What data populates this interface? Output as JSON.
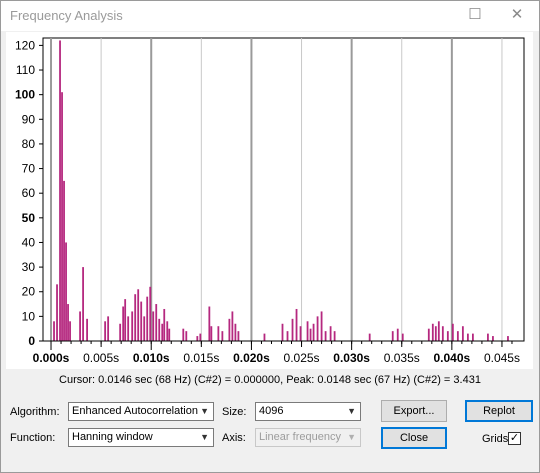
{
  "window": {
    "title": "Frequency Analysis",
    "maximize_glyph": "☐",
    "close_glyph": "✕"
  },
  "chart_data": {
    "type": "bar",
    "y_ticks": [
      "120",
      "110",
      "100",
      "90",
      "80",
      "70",
      "60",
      "50",
      "40",
      "30",
      "20",
      "10",
      "0"
    ],
    "bold_y_ticks": [
      "100",
      "50",
      "0"
    ],
    "x_ticks": [
      "0.000s",
      "0.005s",
      "0.010s",
      "0.015s",
      "0.020s",
      "0.025s",
      "0.030s",
      "0.035s",
      "0.040s",
      "0.045s"
    ],
    "bold_x_ticks": [
      "0.000s",
      "0.010s",
      "0.020s",
      "0.030s",
      "0.040s"
    ],
    "xlim": [
      -0.0008,
      0.0472
    ],
    "ylim": [
      0,
      123
    ],
    "grid": true,
    "color": "#b5287f",
    "points": [
      [
        0.0003,
        8
      ],
      [
        0.0006,
        23
      ],
      [
        0.0009,
        122
      ],
      [
        0.0011,
        101
      ],
      [
        0.0013,
        65
      ],
      [
        0.0015,
        40
      ],
      [
        0.0017,
        15
      ],
      [
        0.0019,
        8
      ],
      [
        0.0029,
        12
      ],
      [
        0.0032,
        30
      ],
      [
        0.0036,
        9
      ],
      [
        0.0054,
        8
      ],
      [
        0.0057,
        10
      ],
      [
        0.0069,
        7
      ],
      [
        0.0072,
        14
      ],
      [
        0.0074,
        17
      ],
      [
        0.0077,
        10
      ],
      [
        0.0081,
        12
      ],
      [
        0.0084,
        19
      ],
      [
        0.0087,
        21
      ],
      [
        0.009,
        16
      ],
      [
        0.0093,
        10
      ],
      [
        0.0096,
        18
      ],
      [
        0.0099,
        22
      ],
      [
        0.0102,
        12
      ],
      [
        0.0105,
        15
      ],
      [
        0.0108,
        9
      ],
      [
        0.0111,
        7
      ],
      [
        0.0113,
        13
      ],
      [
        0.0116,
        8
      ],
      [
        0.0118,
        5
      ],
      [
        0.0132,
        5
      ],
      [
        0.0135,
        4
      ],
      [
        0.0146,
        2
      ],
      [
        0.0149,
        3
      ],
      [
        0.0158,
        14
      ],
      [
        0.016,
        6
      ],
      [
        0.0167,
        6
      ],
      [
        0.0171,
        4
      ],
      [
        0.0178,
        9
      ],
      [
        0.0181,
        12
      ],
      [
        0.0184,
        7
      ],
      [
        0.0187,
        4
      ],
      [
        0.0213,
        3
      ],
      [
        0.0231,
        7
      ],
      [
        0.0236,
        4
      ],
      [
        0.0241,
        9
      ],
      [
        0.0245,
        13
      ],
      [
        0.0249,
        6
      ],
      [
        0.0256,
        8
      ],
      [
        0.0259,
        5
      ],
      [
        0.0262,
        7
      ],
      [
        0.0266,
        10
      ],
      [
        0.027,
        12
      ],
      [
        0.0274,
        4
      ],
      [
        0.0279,
        6
      ],
      [
        0.0283,
        4
      ],
      [
        0.0318,
        3
      ],
      [
        0.0341,
        4
      ],
      [
        0.0346,
        5
      ],
      [
        0.0351,
        3
      ],
      [
        0.0377,
        5
      ],
      [
        0.0381,
        7
      ],
      [
        0.0384,
        6
      ],
      [
        0.0387,
        8
      ],
      [
        0.0391,
        6
      ],
      [
        0.0396,
        4
      ],
      [
        0.0401,
        7
      ],
      [
        0.0406,
        4
      ],
      [
        0.0411,
        6
      ],
      [
        0.0416,
        3
      ],
      [
        0.0421,
        3
      ],
      [
        0.0436,
        3
      ],
      [
        0.0441,
        2
      ],
      [
        0.0456,
        2
      ]
    ]
  },
  "status": {
    "text": "Cursor: 0.0146 sec (68 Hz) (C#2) = 0.000000,    Peak: 0.0148 sec (67 Hz) (C#2) = 3.431"
  },
  "controls": {
    "algorithm_label": "Algorithm:",
    "algorithm_value": "Enhanced Autocorrelation",
    "size_label": "Size:",
    "size_value": "4096",
    "export_label": "Export...",
    "replot_label": "Replot",
    "function_label": "Function:",
    "function_value": "Hanning window",
    "axis_label": "Axis:",
    "axis_value": "Linear frequency",
    "close_label": "Close",
    "grids_label": "Grids",
    "grids_checked": "✓"
  }
}
